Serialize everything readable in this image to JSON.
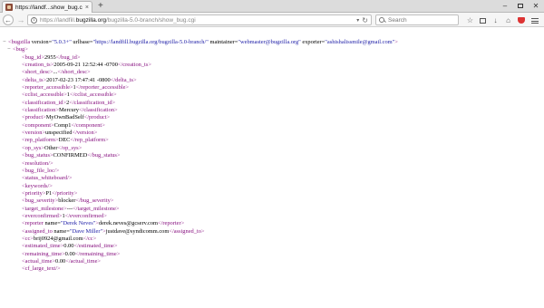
{
  "browser": {
    "tab_title": "https://landf...show_bug.cgi",
    "tab_close": "×",
    "new_tab": "+",
    "win_min": "–",
    "win_close": "✕",
    "url_prefix": "https://landfill.",
    "url_domain": "bugzilla.org",
    "url_path": "/bugzilla-5.0-branch/show_bug.cgi",
    "search_placeholder": "Search",
    "back_glyph": "←",
    "forward_glyph": "→",
    "reload_glyph": "↻",
    "dropdown_glyph": "▾",
    "star_glyph": "☆",
    "home_glyph": "⌂",
    "info_glyph": "i"
  },
  "xml": {
    "root_toggle": "−",
    "root_open": "<bugzilla ",
    "attr_version": "version=",
    "val_version": "\"5.0.3+\"",
    "attr_urlbase": " urlbase=",
    "val_urlbase": "\"https://landfill.bugzilla.org/bugzilla-5.0-branch/\"",
    "attr_maintainer": " maintainer=",
    "val_maintainer": "\"webmaster@bugzilla.org\"",
    "attr_exporter": " exporter=",
    "val_exporter": "\"ashishalissmile@gmail.com\"",
    "root_close": ">",
    "bug_toggle": "−",
    "bug_open": "<bug>",
    "fields": [
      {
        "open": "<bug_id>",
        "value": "2955",
        "close": "</bug_id>"
      },
      {
        "open": "<creation_ts>",
        "value": "2005-09-21 12:52:44 -0700",
        "close": "</creation_ts>"
      },
      {
        "open": "<short_desc>",
        "value": "...",
        "close": "</short_desc>"
      },
      {
        "open": "<delta_ts>",
        "value": "2017-02-23 17:47:41 -0800",
        "close": "</delta_ts>"
      },
      {
        "open": "<reporter_accessible>",
        "value": "1",
        "close": "</reporter_accessible>"
      },
      {
        "open": "<cclist_accessible>",
        "value": "1",
        "close": "</cclist_accessible>"
      },
      {
        "open": "<classification_id>",
        "value": "2",
        "close": "</classification_id>"
      },
      {
        "open": "<classification>",
        "value": "Mercury",
        "close": "</classification>"
      },
      {
        "open": "<product>",
        "value": "MyOwnBadSelf",
        "close": "</product>"
      },
      {
        "open": "<component>",
        "value": "Comp1",
        "close": "</component>"
      },
      {
        "open": "<version>",
        "value": "unspecified",
        "close": "</version>"
      },
      {
        "open": "<rep_platform>",
        "value": "DEC",
        "close": "</rep_platform>"
      },
      {
        "open": "<op_sys>",
        "value": "Other",
        "close": "</op_sys>"
      },
      {
        "open": "<bug_status>",
        "value": "CONFIRMED",
        "close": "</bug_status>"
      },
      {
        "open": "<resolution/>",
        "value": "",
        "close": ""
      },
      {
        "open": "<bug_file_loc/>",
        "value": "",
        "close": ""
      },
      {
        "open": "<status_whiteboard/>",
        "value": "",
        "close": ""
      },
      {
        "open": "<keywords/>",
        "value": "",
        "close": ""
      },
      {
        "open": "<priority>",
        "value": "P1",
        "close": "</priority>"
      },
      {
        "open": "<bug_severity>",
        "value": "blocker",
        "close": "</bug_severity>"
      },
      {
        "open": "<target_milestone>",
        "value": "---",
        "close": "</target_milestone>"
      },
      {
        "open": "<everconfirmed>",
        "value": "1",
        "close": "</everconfirmed>"
      }
    ],
    "reporter": {
      "open": "<reporter ",
      "attr": "name=",
      "val": "\"Derek Neves\"",
      "gt": ">",
      "value": "derek.neves@gcserv.com",
      "close": "</reporter>"
    },
    "assigned": {
      "open": "<assigned_to ",
      "attr": "name=",
      "val": "\"Dave Miller\"",
      "gt": ">",
      "value": "justdave@syndicomm.com",
      "close": "</assigned_to>"
    },
    "fields_after": [
      {
        "open": "<cc>",
        "value": "brij0924@gmail.com",
        "close": "</cc>"
      },
      {
        "open": "<estimated_time>",
        "value": "0.00",
        "close": "</estimated_time>"
      },
      {
        "open": "<remaining_time>",
        "value": "0.00",
        "close": "</remaining_time>"
      },
      {
        "open": "<actual_time>",
        "value": "0.00",
        "close": "</actual_time>"
      },
      {
        "open": "<cf_large_text/>",
        "value": "",
        "close": ""
      }
    ]
  }
}
